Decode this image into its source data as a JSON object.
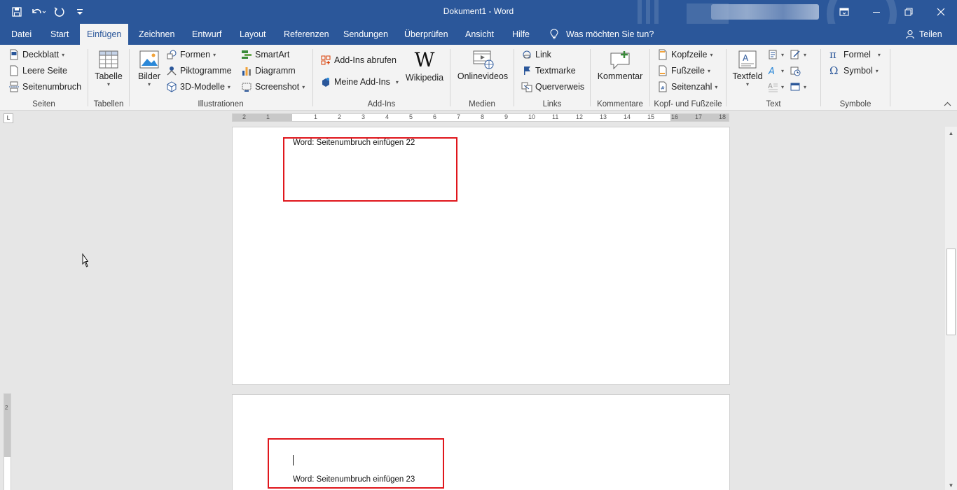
{
  "window": {
    "title": "Dokument1  -  Word"
  },
  "tabs": [
    {
      "label": "Datei"
    },
    {
      "label": "Start"
    },
    {
      "label": "Einfügen"
    },
    {
      "label": "Zeichnen"
    },
    {
      "label": "Entwurf"
    },
    {
      "label": "Layout"
    },
    {
      "label": "Referenzen"
    },
    {
      "label": "Sendungen"
    },
    {
      "label": "Überprüfen"
    },
    {
      "label": "Ansicht"
    },
    {
      "label": "Hilfe"
    }
  ],
  "tell_me": "Was möchten Sie tun?",
  "share": "Teilen",
  "ribbon": {
    "seiten": {
      "label": "Seiten",
      "deckblatt": "Deckblatt",
      "leere_seite": "Leere Seite",
      "seitenumbruch": "Seitenumbruch"
    },
    "tabellen": {
      "label": "Tabellen",
      "tabelle": "Tabelle"
    },
    "illustrationen": {
      "label": "Illustrationen",
      "bilder": "Bilder",
      "formen": "Formen",
      "piktogramme": "Piktogramme",
      "modelle": "3D-Modelle",
      "smartart": "SmartArt",
      "diagramm": "Diagramm",
      "screenshot": "Screenshot"
    },
    "addins": {
      "label": "Add-Ins",
      "abrufen": "Add-Ins abrufen",
      "meine": "Meine Add-Ins",
      "wikipedia": "Wikipedia"
    },
    "medien": {
      "label": "Medien",
      "onlinevideos": "Onlinevideos"
    },
    "links": {
      "label": "Links",
      "link": "Link",
      "textmarke": "Textmarke",
      "querverweis": "Querverweis"
    },
    "kommentare": {
      "label": "Kommentare",
      "kommentar": "Kommentar"
    },
    "kopf": {
      "label": "Kopf- und Fußzeile",
      "kopfzeile": "Kopfzeile",
      "fusszeile": "Fußzeile",
      "seitenzahl": "Seitenzahl"
    },
    "text": {
      "label": "Text",
      "textfeld": "Textfeld"
    },
    "symbole": {
      "label": "Symbole",
      "formel": "Formel",
      "symbol": "Symbol"
    }
  },
  "ruler": {
    "numbers": [
      "2",
      "1",
      "1",
      "2",
      "3",
      "4",
      "5",
      "6",
      "7",
      "8",
      "9",
      "10",
      "11",
      "12",
      "13",
      "14",
      "15",
      "16",
      "17",
      "18"
    ],
    "vertical_label": "2"
  },
  "document": {
    "page1_text": "Word: Seitenumbruch einfügen 22",
    "page2_text": "Word: Seitenumbruch einfügen 23"
  },
  "colors": {
    "accent": "#2b579a",
    "highlight_box": "#e0161c"
  }
}
